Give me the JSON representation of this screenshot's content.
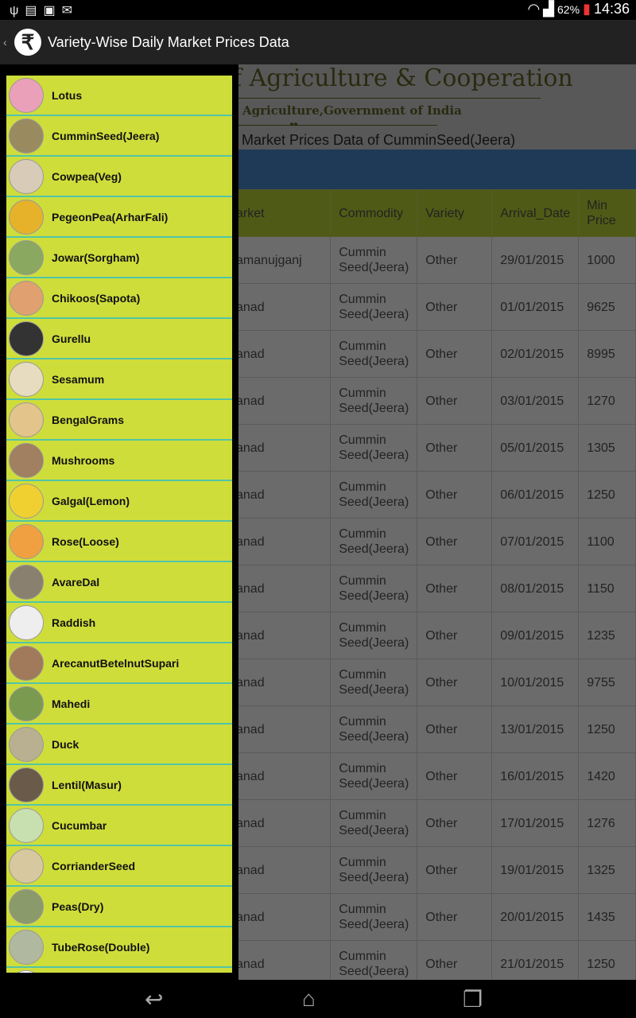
{
  "status_bar": {
    "left_icons": [
      "usb-icon",
      "sim-icon",
      "image-icon",
      "gmail-icon"
    ],
    "battery": "62%",
    "time": "14:36"
  },
  "action_bar": {
    "title": "Variety-Wise Daily Market Prices Data",
    "logo": "rupee-icon"
  },
  "banner": {
    "heading": "f Agriculture & Cooperation",
    "subheading": "Agriculture,Government of  India",
    "page_title": "Market Prices Data of CumminSeed(Jeera)"
  },
  "table": {
    "headers": [
      "arket",
      "Commodity",
      "Variety",
      "Arrival_Date",
      "Min Price"
    ],
    "rows": [
      [
        "amanujganj",
        "Cummin Seed(Jeera)",
        "Other",
        "29/01/2015",
        "1000"
      ],
      [
        "anad",
        "Cummin Seed(Jeera)",
        "Other",
        "01/01/2015",
        "9625"
      ],
      [
        "anad",
        "Cummin Seed(Jeera)",
        "Other",
        "02/01/2015",
        "8995"
      ],
      [
        "anad",
        "Cummin Seed(Jeera)",
        "Other",
        "03/01/2015",
        "1270"
      ],
      [
        "anad",
        "Cummin Seed(Jeera)",
        "Other",
        "05/01/2015",
        "1305"
      ],
      [
        "anad",
        "Cummin Seed(Jeera)",
        "Other",
        "06/01/2015",
        "1250"
      ],
      [
        "anad",
        "Cummin Seed(Jeera)",
        "Other",
        "07/01/2015",
        "1100"
      ],
      [
        "anad",
        "Cummin Seed(Jeera)",
        "Other",
        "08/01/2015",
        "1150"
      ],
      [
        "anad",
        "Cummin Seed(Jeera)",
        "Other",
        "09/01/2015",
        "1235"
      ],
      [
        "anad",
        "Cummin Seed(Jeera)",
        "Other",
        "10/01/2015",
        "9755"
      ],
      [
        "anad",
        "Cummin Seed(Jeera)",
        "Other",
        "13/01/2015",
        "1250"
      ],
      [
        "anad",
        "Cummin Seed(Jeera)",
        "Other",
        "16/01/2015",
        "1420"
      ],
      [
        "anad",
        "Cummin Seed(Jeera)",
        "Other",
        "17/01/2015",
        "1276"
      ],
      [
        "anad",
        "Cummin Seed(Jeera)",
        "Other",
        "19/01/2015",
        "1325"
      ],
      [
        "anad",
        "Cummin Seed(Jeera)",
        "Other",
        "20/01/2015",
        "1435"
      ],
      [
        "anad",
        "Cummin Seed(Jeera)",
        "Other",
        "21/01/2015",
        "1250"
      ]
    ]
  },
  "drawer": {
    "items": [
      {
        "label": "Lotus",
        "color": "#e9a0b8"
      },
      {
        "label": "CumminSeed(Jeera)",
        "color": "#9a8a60"
      },
      {
        "label": "Cowpea(Veg)",
        "color": "#d8cbb8"
      },
      {
        "label": "PegeonPea(ArharFali)",
        "color": "#e6b22a"
      },
      {
        "label": "Jowar(Sorgham)",
        "color": "#8aa860"
      },
      {
        "label": "Chikoos(Sapota)",
        "color": "#e0a070"
      },
      {
        "label": "Gurellu",
        "color": "#333333"
      },
      {
        "label": "Sesamum",
        "color": "#e8dcc0"
      },
      {
        "label": "BengalGrams",
        "color": "#e3c48a"
      },
      {
        "label": "Mushrooms",
        "color": "#a08060"
      },
      {
        "label": "Galgal(Lemon)",
        "color": "#f0d030"
      },
      {
        "label": "Rose(Loose)",
        "color": "#f0a040"
      },
      {
        "label": "AvareDal",
        "color": "#8a8070"
      },
      {
        "label": "Raddish",
        "color": "#eeeeee"
      },
      {
        "label": "ArecanutBetelnutSupari",
        "color": "#a07a5a"
      },
      {
        "label": "Mahedi",
        "color": "#7a9a50"
      },
      {
        "label": "Duck",
        "color": "#b8b090"
      },
      {
        "label": "Lentil(Masur)",
        "color": "#6a5a4a"
      },
      {
        "label": "Cucumbar",
        "color": "#c8e0b0"
      },
      {
        "label": "CorrianderSeed",
        "color": "#d8c8a0"
      },
      {
        "label": "Peas(Dry)",
        "color": "#8a9a6a"
      },
      {
        "label": "TubeRose(Double)",
        "color": "#b0b8a0"
      },
      {
        "label": "",
        "color": "#ffffff"
      }
    ]
  },
  "nav": {
    "icons": [
      "back-icon",
      "home-icon",
      "recents-icon"
    ]
  },
  "colors": {
    "drawer_bg": "#cfdd3b",
    "divider": "#52c5a6",
    "table_header": "#4f5a16",
    "band": "#1f3a57"
  }
}
